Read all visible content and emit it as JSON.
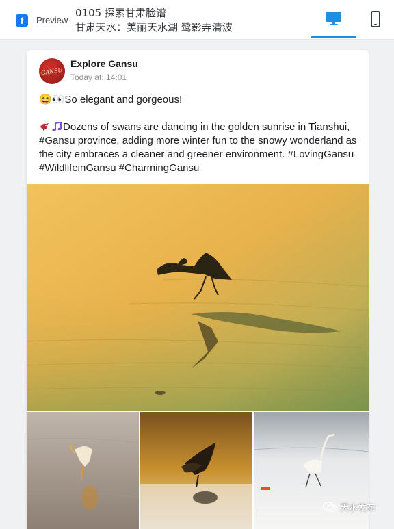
{
  "header": {
    "platform_icon": "facebook-icon",
    "preview_label": "Preview",
    "title_line1": "0105 探索甘肃脸谱",
    "title_line2": "甘肃天水：美丽天水湖 鹭影弄清波",
    "device_modes": [
      {
        "name": "desktop",
        "icon": "desktop-icon",
        "active": true
      },
      {
        "name": "mobile",
        "icon": "mobile-icon",
        "active": false
      }
    ],
    "accent_color": "#1a8fe3"
  },
  "post": {
    "author": "Explore Gansu",
    "avatar_text": "GANSU",
    "timestamp": "Today at: 14:01",
    "line1_emoji": "😄👀",
    "line1_text": "So elegant and gorgeous!",
    "body_text": "Dozens of swans are dancing in the golden sunrise in Tianshui, #Gansu province, adding more winter fun to the snowy wonderland as the city embraces a cleaner and greener environment. #LovingGansu #WildlifeinGansu #CharmingGansu",
    "body_emoji_icons": [
      "bird-icon",
      "music-note-icon"
    ],
    "images": [
      {
        "name": "main-photo",
        "subject": "heron landing on golden water"
      },
      {
        "name": "thumb-1",
        "subject": "egret on sandy water"
      },
      {
        "name": "thumb-2",
        "subject": "heron at golden sunset"
      },
      {
        "name": "thumb-3",
        "subject": "egrets on ice"
      }
    ]
  },
  "watermark": {
    "icon": "wechat-icon",
    "text": "天水发布"
  }
}
